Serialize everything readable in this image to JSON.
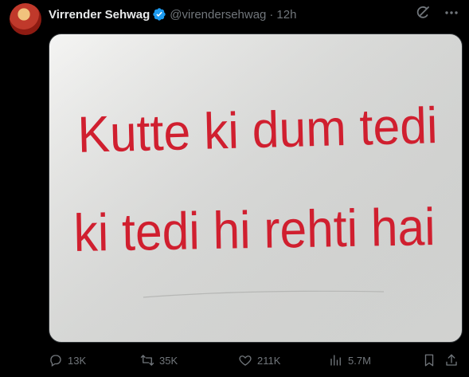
{
  "author": {
    "display_name": "Virrender Sehwag",
    "handle": "@virendersehwag",
    "separator": "·",
    "time": "12h"
  },
  "top_icons": [
    "grok-icon",
    "more-icon"
  ],
  "media": {
    "painted_text_line1": "Kutte ki dum tedi",
    "painted_text_line2": "ki tedi hi rehti hai",
    "paint_color": "#d01f2f"
  },
  "actions": {
    "replies": "13K",
    "reposts": "35K",
    "likes": "211K",
    "views": "5.7M"
  },
  "colors": {
    "background": "#000000",
    "primary_text": "#e7e9ea",
    "secondary_text": "#71767b",
    "verified": "#1d9bf0"
  }
}
